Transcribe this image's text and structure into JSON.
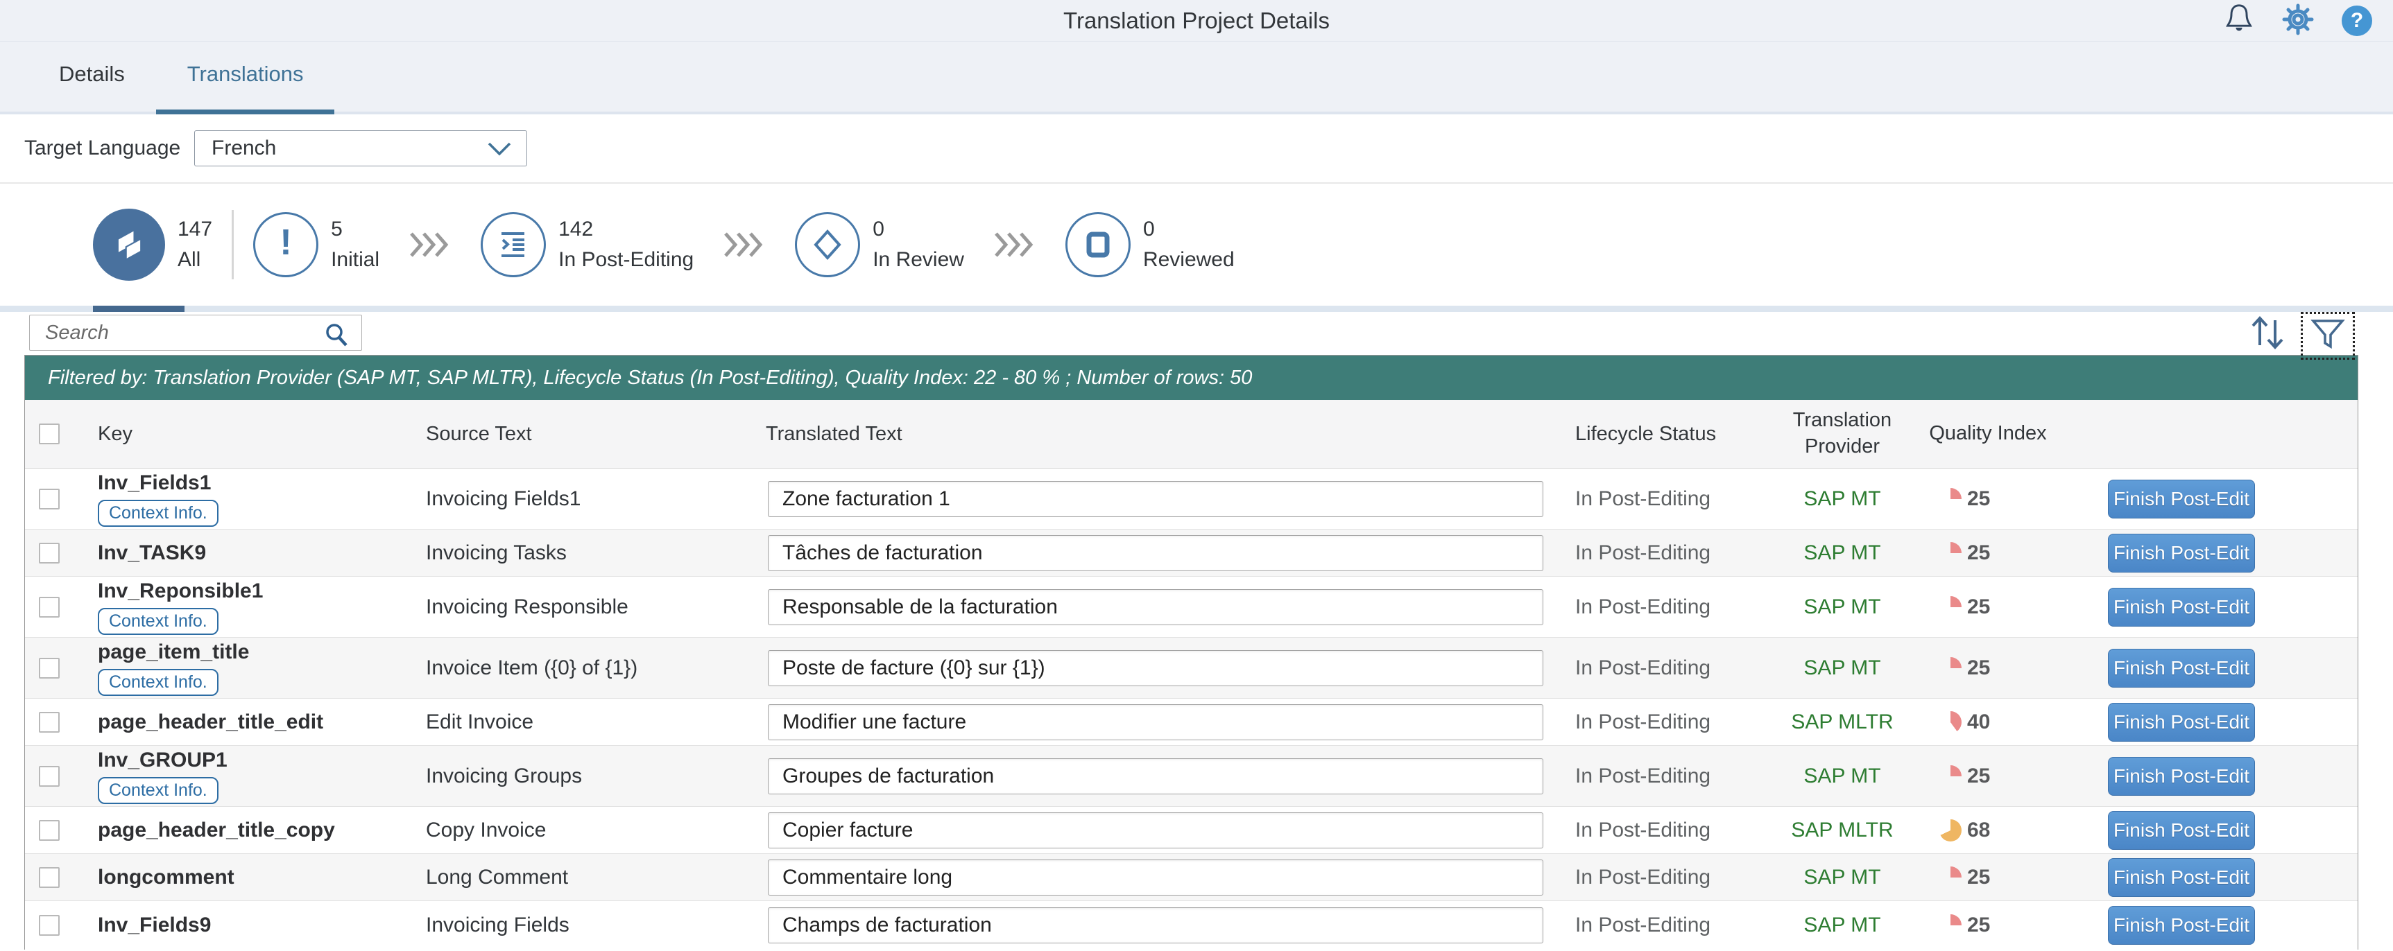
{
  "header": {
    "title": "Translation Project Details"
  },
  "tabs": [
    {
      "label": "Details"
    },
    {
      "label": "Translations"
    }
  ],
  "target_language": {
    "label": "Target Language",
    "value": "French"
  },
  "funnel": {
    "stages": [
      {
        "count": "147",
        "label": "All"
      },
      {
        "count": "5",
        "label": "Initial"
      },
      {
        "count": "142",
        "label": "In Post-Editing"
      },
      {
        "count": "0",
        "label": "In Review"
      },
      {
        "count": "0",
        "label": "Reviewed"
      }
    ]
  },
  "search": {
    "placeholder": "Search"
  },
  "filter_bar": "Filtered by: Translation Provider (SAP MT, SAP MLTR), Lifecycle Status (In Post-Editing), Quality Index: 22 - 80 % ; Number of rows: 50",
  "table": {
    "columns": [
      "Key",
      "Source Text",
      "Translated Text",
      "Lifecycle Status",
      "Translation Provider",
      "Quality Index"
    ],
    "action_label": "Finish Post-Edit",
    "rows": [
      {
        "key": "Inv_Fields1",
        "context": "Context Info.",
        "source": "Invoicing Fields1",
        "translated": "Zone facturation 1",
        "status": "In Post-Editing",
        "provider": "SAP MT",
        "quality": 25,
        "quality_color": "#ea8a8a"
      },
      {
        "key": "Inv_TASK9",
        "context": "",
        "source": "Invoicing Tasks",
        "translated": "Tâches de facturation",
        "status": "In Post-Editing",
        "provider": "SAP MT",
        "quality": 25,
        "quality_color": "#ea8a8a"
      },
      {
        "key": "Inv_Reponsible1",
        "context": "Context Info.",
        "source": "Invoicing Responsible",
        "translated": "Responsable de la facturation",
        "status": "In Post-Editing",
        "provider": "SAP MT",
        "quality": 25,
        "quality_color": "#ea8a8a"
      },
      {
        "key": "page_item_title",
        "context": "Context Info.",
        "source": "Invoice Item ({0} of {1})",
        "translated": "Poste de facture ({0} sur {1})",
        "status": "In Post-Editing",
        "provider": "SAP MT",
        "quality": 25,
        "quality_color": "#ea8a8a"
      },
      {
        "key": "page_header_title_edit",
        "context": "",
        "source": "Edit Invoice",
        "translated": "Modifier une facture",
        "status": "In Post-Editing",
        "provider": "SAP MLTR",
        "quality": 40,
        "quality_color": "#ea8a8a"
      },
      {
        "key": "Inv_GROUP1",
        "context": "Context Info.",
        "source": "Invoicing Groups",
        "translated": "Groupes de facturation",
        "status": "In Post-Editing",
        "provider": "SAP MT",
        "quality": 25,
        "quality_color": "#ea8a8a"
      },
      {
        "key": "page_header_title_copy",
        "context": "",
        "source": "Copy Invoice",
        "translated": "Copier facture",
        "status": "In Post-Editing",
        "provider": "SAP MLTR",
        "quality": 68,
        "quality_color": "#efb662"
      },
      {
        "key": "longcomment",
        "context": "",
        "source": "Long Comment",
        "translated": "Commentaire long",
        "status": "In Post-Editing",
        "provider": "SAP MT",
        "quality": 25,
        "quality_color": "#ea8a8a"
      },
      {
        "key": "Inv_Fields9",
        "context": "",
        "source": "Invoicing Fields",
        "translated": "Champs de facturation",
        "status": "In Post-Editing",
        "provider": "SAP MT",
        "quality": 25,
        "quality_color": "#ea8a8a"
      }
    ]
  }
}
